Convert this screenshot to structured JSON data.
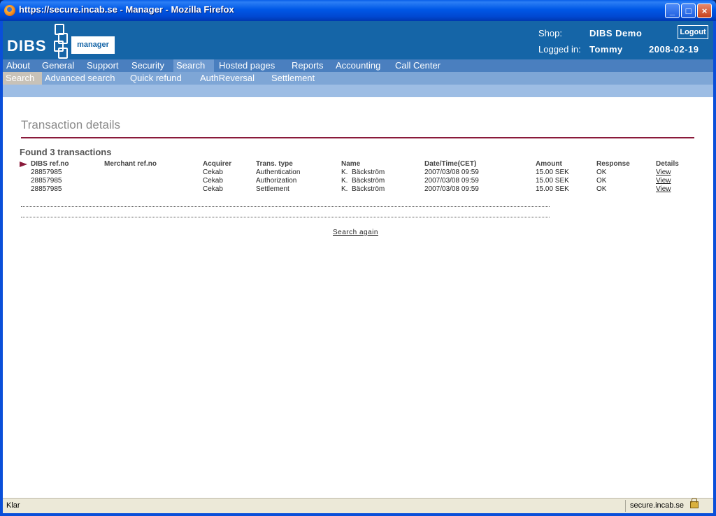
{
  "window": {
    "title": "https://secure.incab.se - Manager - Mozilla Firefox",
    "buttons": {
      "minimize": "_",
      "maximize": "□",
      "close": "×"
    }
  },
  "header": {
    "logo_text": "DIBS",
    "manager_label": "manager",
    "shop_label": "Shop:",
    "shop_value": "DIBS Demo",
    "logged_in_label": "Logged in:",
    "user": "Tommy",
    "date": "2008-02-19",
    "logout_label": "Logout"
  },
  "nav": {
    "main": [
      "About",
      "General",
      "Support",
      "Security",
      "Search",
      "Hosted pages",
      "Reports",
      "Accounting",
      "Call Center"
    ],
    "active_main": "Search",
    "sub": [
      "Search",
      "Advanced search",
      "Quick refund",
      "AuthReversal",
      "Settlement"
    ],
    "active_sub": "Search"
  },
  "main": {
    "title": "Transaction details",
    "found_text": "Found 3 transactions",
    "columns": [
      "DIBS ref.no",
      "Merchant ref.no",
      "Acquirer",
      "Trans. type",
      "Name",
      "Date/Time(CET)",
      "Amount",
      "Response",
      "Details"
    ],
    "rows": [
      {
        "dibs_ref": "28857985",
        "merchant_ref": "",
        "acquirer": "Cekab",
        "trans_type": "Authentication",
        "name": "K.  Bäckström",
        "datetime": "2007/03/08 09:59",
        "amount": "15.00 SEK",
        "response": "OK",
        "details": "View"
      },
      {
        "dibs_ref": "28857985",
        "merchant_ref": "",
        "acquirer": "Cekab",
        "trans_type": "Authorization",
        "name": "K.  Bäckström",
        "datetime": "2007/03/08 09:59",
        "amount": "15.00 SEK",
        "response": "OK",
        "details": "View"
      },
      {
        "dibs_ref": "28857985",
        "merchant_ref": "",
        "acquirer": "Cekab",
        "trans_type": "Settlement",
        "name": "K.  Bäckström",
        "datetime": "2007/03/08 09:59",
        "amount": "15.00 SEK",
        "response": "OK",
        "details": "View"
      }
    ],
    "search_again_label": "Search again"
  },
  "statusbar": {
    "status": "Klar",
    "host": "secure.incab.se"
  },
  "colors": {
    "header_bg": "#1565a7",
    "accent_rule": "#8a1a3a"
  }
}
